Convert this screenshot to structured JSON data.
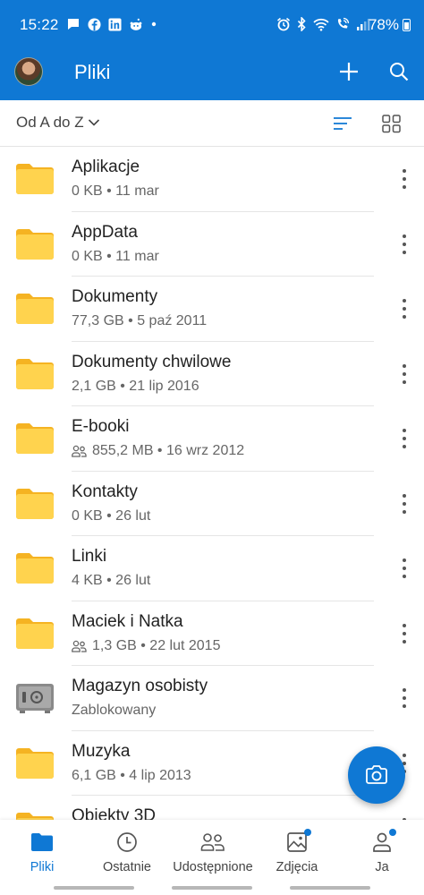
{
  "status_bar": {
    "time": "15:22",
    "battery": "78%",
    "icons_left": [
      "chat-icon",
      "facebook-icon",
      "linkedin-icon",
      "reddit-icon",
      "dot-icon"
    ],
    "icons_right": [
      "alarm-icon",
      "bluetooth-icon",
      "wifi-icon",
      "wifi-call-icon",
      "signal-icon",
      "battery-icon"
    ]
  },
  "app_bar": {
    "title": "Pliki",
    "icons": [
      "avatar",
      "add-icon",
      "search-icon"
    ]
  },
  "sort_bar": {
    "label": "Od A do Z",
    "view_modes": [
      "list-view-icon",
      "grid-view-icon"
    ],
    "active_view": "list"
  },
  "files": [
    {
      "name": "Aplikacje",
      "meta": "0 KB • 11 mar",
      "icon": "folder",
      "shared": false
    },
    {
      "name": "AppData",
      "meta": "0 KB • 11 mar",
      "icon": "folder",
      "shared": false
    },
    {
      "name": "Dokumenty",
      "meta": "77,3 GB • 5 paź 2011",
      "icon": "folder",
      "shared": false
    },
    {
      "name": "Dokumenty chwilowe",
      "meta": "2,1 GB • 21 lip 2016",
      "icon": "folder",
      "shared": false
    },
    {
      "name": "E-booki",
      "meta": "855,2 MB • 16 wrz 2012",
      "icon": "folder",
      "shared": true
    },
    {
      "name": "Kontakty",
      "meta": "0 KB • 26 lut",
      "icon": "folder",
      "shared": false
    },
    {
      "name": "Linki",
      "meta": "4 KB • 26 lut",
      "icon": "folder",
      "shared": false
    },
    {
      "name": "Maciek i Natka",
      "meta": "1,3 GB • 22 lut 2015",
      "icon": "folder",
      "shared": true
    },
    {
      "name": "Magazyn osobisty",
      "meta": "Zablokowany",
      "icon": "vault",
      "shared": false
    },
    {
      "name": "Muzyka",
      "meta": "6,1 GB • 4 lip 2013",
      "icon": "folder",
      "shared": false
    },
    {
      "name": "Obiekty 3D",
      "meta": "",
      "icon": "folder",
      "shared": false
    }
  ],
  "fab": {
    "icon": "camera-icon"
  },
  "bottom_nav": [
    {
      "label": "Pliki",
      "icon": "folder-icon",
      "active": true,
      "badge": false
    },
    {
      "label": "Ostatnie",
      "icon": "clock-icon",
      "active": false,
      "badge": false
    },
    {
      "label": "Udostępnione",
      "icon": "people-icon",
      "active": false,
      "badge": false
    },
    {
      "label": "Zdjęcia",
      "icon": "photo-icon",
      "active": false,
      "badge": true
    },
    {
      "label": "Ja",
      "icon": "person-icon",
      "active": false,
      "badge": true
    }
  ],
  "colors": {
    "brand": "#0f78d4",
    "folder": "#ffc83d",
    "folder_back": "#f5b322",
    "text_primary": "#222222",
    "text_secondary": "#666666"
  }
}
